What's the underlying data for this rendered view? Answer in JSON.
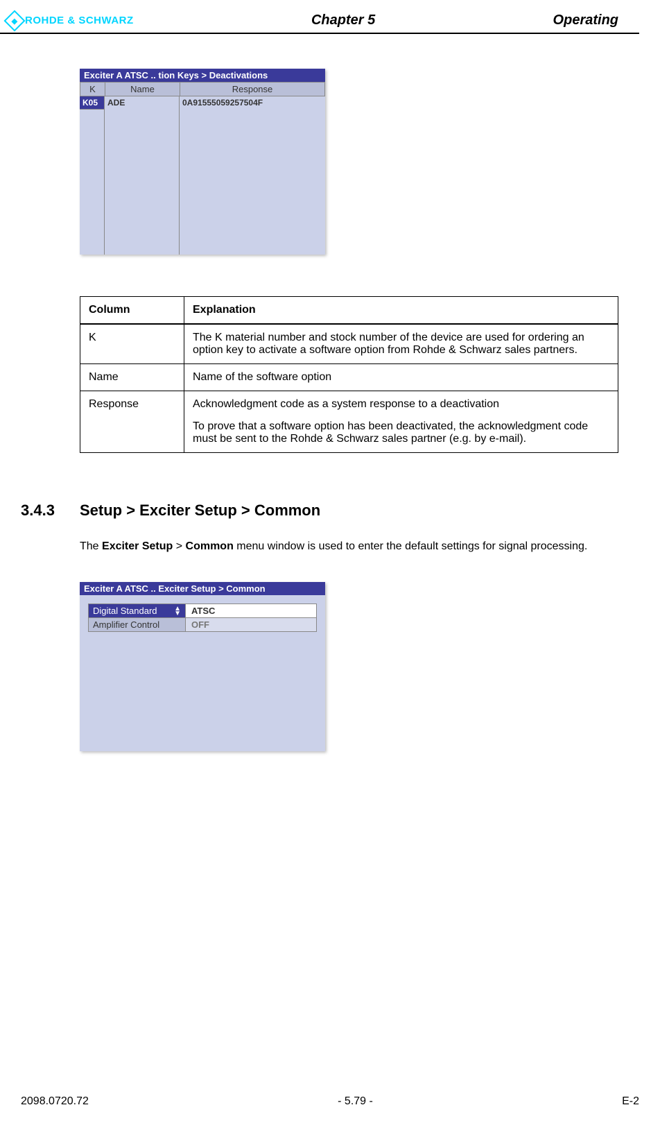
{
  "header": {
    "logo_text": "ROHDE & SCHWARZ",
    "chapter": "Chapter 5",
    "right": "Operating"
  },
  "screenshot1": {
    "title": "Exciter A  ATSC  .. tion Keys > Deactivations",
    "headers": {
      "k": "K",
      "name": "Name",
      "response": "Response"
    },
    "row": {
      "k": "K05",
      "name": "ADE",
      "response": "0A91555059257504F"
    }
  },
  "expl_table": {
    "header_col": "Column",
    "header_exp": "Explanation",
    "rows": [
      {
        "col": "K",
        "exp": "The K material number and stock number of the device are used for ordering an option key to activate a software option from Rohde & Schwarz sales partners."
      },
      {
        "col": "Name",
        "exp": "Name of the software option"
      },
      {
        "col": "Response",
        "exp1": "Acknowledgment code as a system response to a deactivation",
        "exp2": "To prove that a software option has been deactivated, the acknowledgment code must be sent to the Rohde & Schwarz sales partner (e.g. by e-mail)."
      }
    ]
  },
  "section": {
    "num": "3.4.3",
    "title": "Setup > Exciter Setup > Common"
  },
  "body": {
    "prefix": "The ",
    "b1": "Exciter Setup",
    "sep": " > ",
    "b2": "Common",
    "suffix": " menu window is used to enter the default settings for signal processing."
  },
  "screenshot2": {
    "title": "Exciter A ATSC .. Exciter Setup > Common",
    "rows": [
      {
        "label": "Digital Standard",
        "value": "ATSC",
        "selected": true
      },
      {
        "label": "Amplifier Control",
        "value": "OFF",
        "selected": false
      }
    ]
  },
  "footer": {
    "left": "2098.0720.72",
    "center": "- 5.79 -",
    "right": "E-2"
  }
}
